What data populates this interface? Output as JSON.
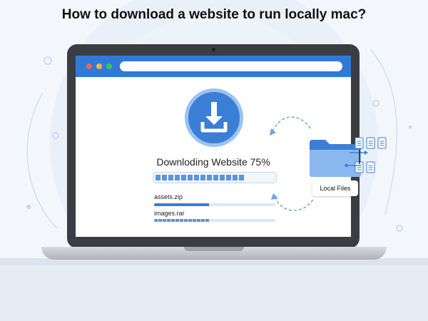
{
  "page": {
    "title": "How to download a website to run locally mac?"
  },
  "browser": {
    "url": ""
  },
  "download": {
    "status": "Downloding Website 75%",
    "progress": 0.75,
    "files": [
      {
        "name": "assets.zip",
        "progress": 0.45
      },
      {
        "name": "images.rar",
        "progress": 0.45
      }
    ]
  },
  "local": {
    "label": "Local Files"
  },
  "icons": [
    "download-icon",
    "folder-icon",
    "document-icon",
    "sync-arrows-icon"
  ],
  "colors": {
    "accent": "#2f7ad8",
    "circle": "#3a7ed6",
    "folder": "#5b9be6",
    "text": "#111111"
  }
}
